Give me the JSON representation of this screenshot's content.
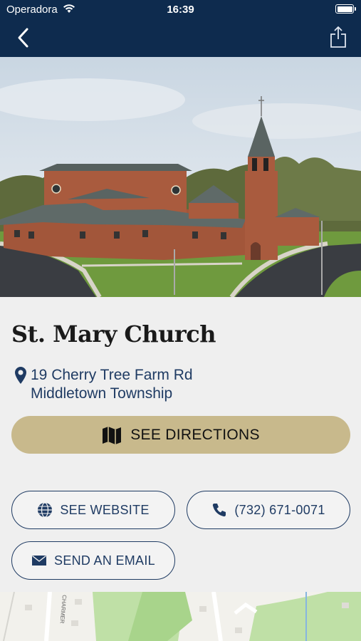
{
  "status_bar": {
    "carrier": "Operadora",
    "time": "16:39"
  },
  "nav": {
    "back_icon": "chevron-left-icon",
    "share_icon": "share-icon"
  },
  "church": {
    "name": "St. Mary Church",
    "address_line1": "19 Cherry Tree Farm Rd",
    "address_line2": "Middletown Township"
  },
  "actions": {
    "directions_label": "SEE DIRECTIONS",
    "website_label": "SEE WEBSITE",
    "phone_label": "(732) 671-0071",
    "email_label": "SEND AN EMAIL"
  },
  "map": {
    "street_label": "CHARMER"
  },
  "colors": {
    "nav_bg": "#0e2b4e",
    "accent_gold": "#c8b98c",
    "text_blue": "#1f3b63",
    "background": "#efefef"
  }
}
